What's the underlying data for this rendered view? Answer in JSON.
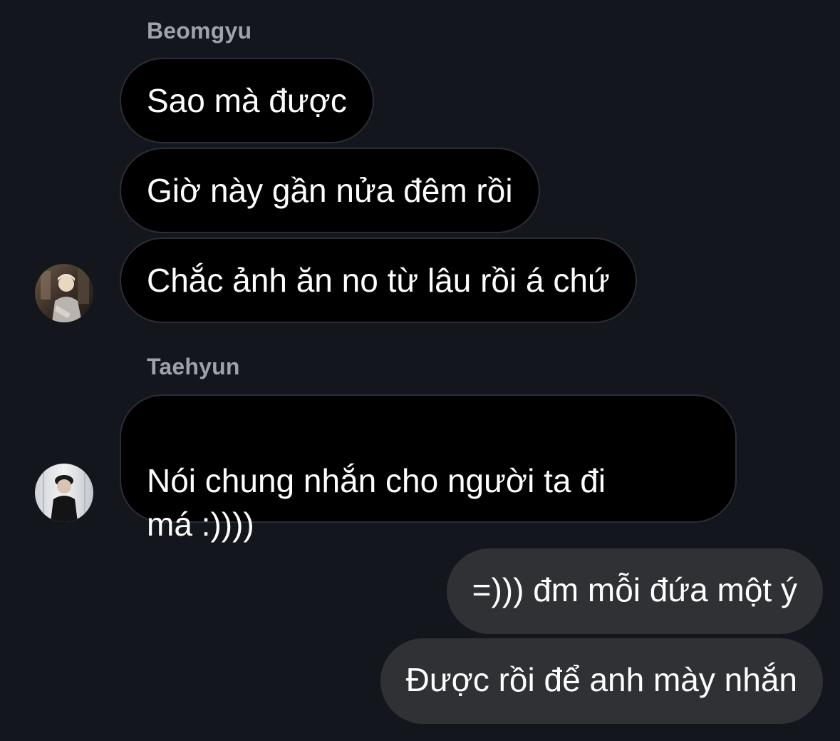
{
  "groups": [
    {
      "sender": "Beomgyu",
      "avatar_icon": "person-photo-icon",
      "messages": [
        "Sao mà được",
        "Giờ này gần nửa đêm rồi",
        "Chắc ảnh ăn no từ lâu rồi á chứ"
      ]
    },
    {
      "sender": "Taehyun",
      "avatar_icon": "person-photo-icon",
      "messages": [
        "Nói chung nhắn cho người ta đi\nmá :))))"
      ]
    }
  ],
  "outgoing": [
    "=))) đm mỗi đứa một ý",
    "Được rồi để anh mày nhắn"
  ],
  "colors": {
    "background": "#13161c",
    "incoming_bubble": "#000000",
    "incoming_border": "#2a2e36",
    "outgoing_bubble": "#303134",
    "sender_name": "#9ea3ab",
    "text": "#ffffff"
  }
}
